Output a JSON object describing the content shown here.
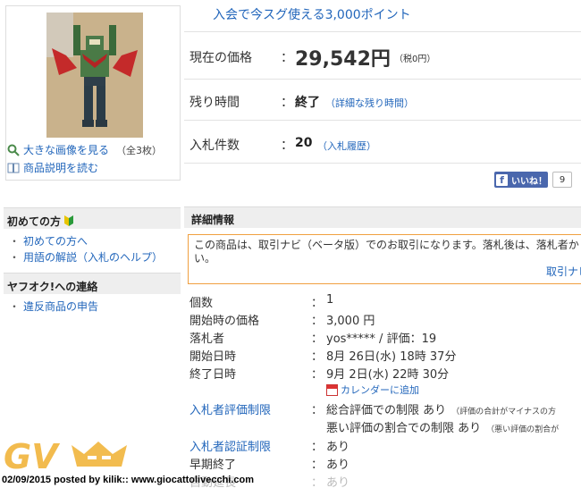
{
  "product": {
    "image_count_label": "（全3枚）",
    "large_image_link": "大きな画像を見る",
    "description_link": "商品説明を読む"
  },
  "promo": {
    "text": "入会で今スグ使える3,000ポイント"
  },
  "summary": {
    "price_label": "現在の価格",
    "price_value": "29,542円",
    "price_tax": "（税0円）",
    "time_label": "残り時間",
    "time_value": "終了",
    "time_link": "（詳細な残り時間）",
    "bids_label": "入札件数",
    "bids_value": "20",
    "bids_link": "（入札履歴）",
    "colon": "："
  },
  "like": {
    "label": "いいね！",
    "count": "9"
  },
  "sidebar": {
    "beginner_heading": "初めての方",
    "beginner_items": [
      "初めての方へ",
      "用語の解説（入札のヘルプ）"
    ],
    "contact_heading": "ヤフオク!への連絡",
    "contact_items": [
      "違反商品の申告"
    ]
  },
  "details": {
    "heading": "詳細情報",
    "notice_text": "この商品は、取引ナビ（ベータ版）でのお取引になります。落札後は、落札者か",
    "notice_text_2": "い。",
    "notice_link": "取引ナビ",
    "rows": [
      {
        "label": "個数",
        "value": "1"
      },
      {
        "label": "開始時の価格",
        "value": "3,000 円"
      },
      {
        "label": "落札者",
        "value": "yos***** / 評価：19"
      },
      {
        "label": "開始日時",
        "value": "8月 26日(水) 18時 37分"
      },
      {
        "label": "終了日時",
        "value": "9月 2日(水) 22時 30分"
      }
    ],
    "calendar_link": "カレンダーに追加",
    "rating_limit_label": "入札者評価制限",
    "rating_limit_value_1": "総合評価での制限 あり",
    "rating_limit_note_1": "（評価の合計がマイナスの方",
    "rating_limit_value_2": "悪い評価の割合での制限 あり",
    "rating_limit_note_2": "（悪い評価の割合が",
    "auth_limit_label": "入札者認証制限",
    "auth_limit_value": "あり",
    "early_end_label": "早期終了",
    "early_end_value": "あり",
    "auto_extend_label": "自動延長",
    "auto_extend_value": "あり"
  },
  "watermark": {
    "logo": "GV",
    "caption": "02/09/2015 posted by kilik:: www.giocattolivecchi.com"
  }
}
